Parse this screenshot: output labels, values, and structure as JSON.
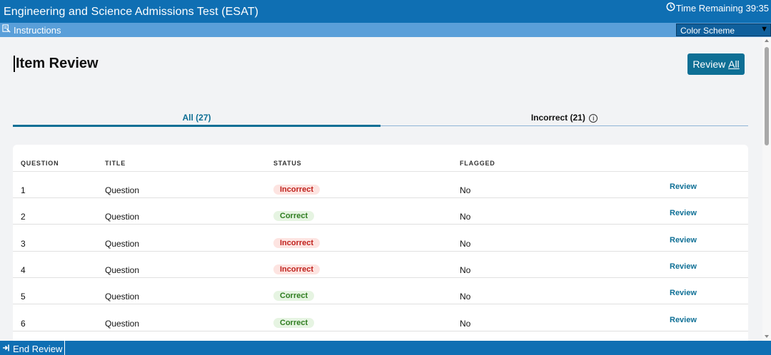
{
  "app": {
    "title": "Engineering and Science Admissions Test (ESAT)",
    "timer_label": "Time Remaining 39:35"
  },
  "toolbar": {
    "instructions_label": "Instructions",
    "color_scheme_label": "Color Scheme"
  },
  "page": {
    "title": "Item Review",
    "review_all_prefix": "Review ",
    "review_all_accesskey": "All"
  },
  "tabs": [
    {
      "label": "All (27)",
      "active": true
    },
    {
      "label": "Incorrect (21)",
      "active": false
    }
  ],
  "table": {
    "headers": {
      "question": "QUESTION",
      "title": "TITLE",
      "status": "STATUS",
      "flagged": "FLAGGED"
    },
    "rows": [
      {
        "question": "1",
        "title": "Question",
        "status": "Incorrect",
        "flagged": "No",
        "action": "Review"
      },
      {
        "question": "2",
        "title": "Question",
        "status": "Correct",
        "flagged": "No",
        "action": "Review"
      },
      {
        "question": "3",
        "title": "Question",
        "status": "Incorrect",
        "flagged": "No",
        "action": "Review"
      },
      {
        "question": "4",
        "title": "Question",
        "status": "Incorrect",
        "flagged": "No",
        "action": "Review"
      },
      {
        "question": "5",
        "title": "Question",
        "status": "Correct",
        "flagged": "No",
        "action": "Review"
      },
      {
        "question": "6",
        "title": "Question",
        "status": "Correct",
        "flagged": "No",
        "action": "Review"
      }
    ]
  },
  "footer": {
    "end_review_label": "End Review"
  },
  "colors": {
    "topbar": "#0f6fb3",
    "subbar": "#5a9fd9",
    "accent": "#0e6f95",
    "incorrect": "#c0211c",
    "correct": "#2e7d1f"
  }
}
